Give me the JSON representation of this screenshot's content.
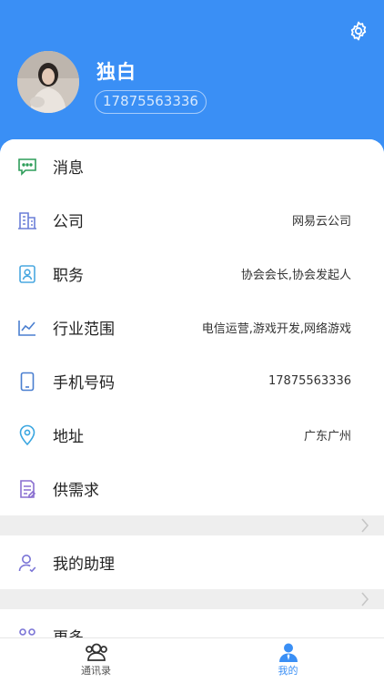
{
  "header": {
    "name": "独白",
    "phone": "17875563336"
  },
  "menu": [
    {
      "label": "消息",
      "value": "",
      "icon": "message-icon",
      "color": "#2e9d5a"
    },
    {
      "label": "公司",
      "value": "网易云公司",
      "icon": "building-icon",
      "color": "#6b7fd7"
    },
    {
      "label": "职务",
      "value": "协会会长,协会发起人",
      "icon": "badge-icon",
      "color": "#4aa8e0"
    },
    {
      "label": "行业范围",
      "value": "电信运营,游戏开发,网络游戏",
      "icon": "chart-icon",
      "color": "#4a7fd0"
    },
    {
      "label": "手机号码",
      "value": "17875563336",
      "icon": "phone-icon",
      "color": "#4a7fd0"
    },
    {
      "label": "地址",
      "value": "广东广州",
      "icon": "location-icon",
      "color": "#3aa6e0"
    },
    {
      "label": "供需求",
      "value": "",
      "icon": "document-icon",
      "color": "#8a6fd0"
    }
  ],
  "assistant": {
    "label": "我的助理",
    "icon": "assistant-icon",
    "color": "#7a74d6"
  },
  "more": {
    "label": "更多"
  },
  "tabs": [
    {
      "label": "通讯录",
      "icon": "contacts-icon",
      "active": false
    },
    {
      "label": "我的",
      "icon": "profile-icon",
      "active": true
    }
  ],
  "colors": {
    "accent": "#3a8ff5",
    "inactive": "#555555"
  }
}
